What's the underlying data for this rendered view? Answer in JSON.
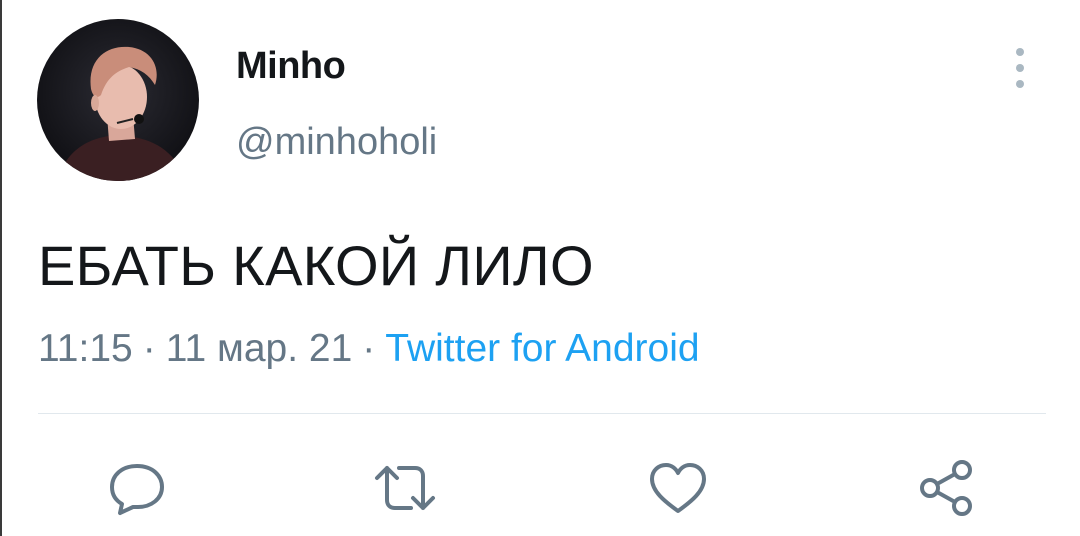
{
  "user": {
    "display_name": "Minho",
    "handle": "@minhoholi"
  },
  "tweet": {
    "text": "ЕБАТЬ КАКОЙ ЛИЛО",
    "time": "11:15",
    "separator": "·",
    "date": "11 мар. 21",
    "source": "Twitter for Android"
  },
  "icons": {
    "more": "more-vertical-icon",
    "reply": "reply-icon",
    "retweet": "retweet-icon",
    "like": "heart-icon",
    "share": "share-icon"
  },
  "colors": {
    "text": "#14171a",
    "secondary": "#657786",
    "link": "#1da1f2",
    "divider": "#e1e8ed",
    "icon": "#657786"
  }
}
